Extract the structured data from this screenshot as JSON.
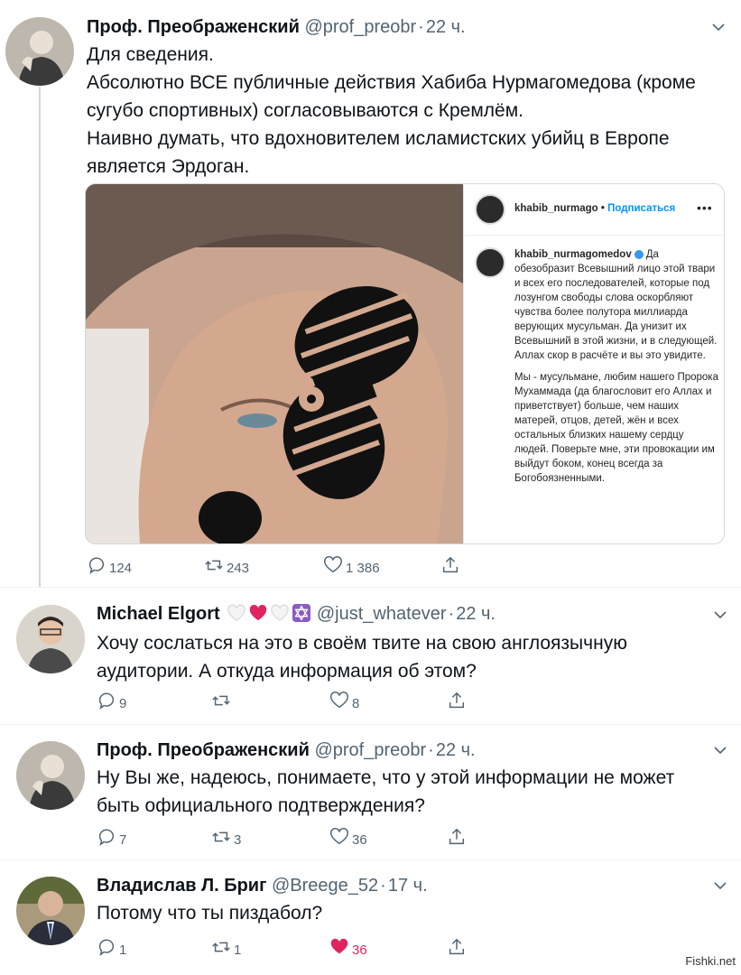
{
  "tweets": [
    {
      "name": "Проф. Преображенский",
      "handle": "@prof_preobr",
      "time": "22 ч.",
      "text": "Для сведения.\nАбсолютно ВСЕ публичные действия Хабиба Нурмагомедова (кроме\nсугубо спортивных) согласовываются с Кремлём.\nНаивно думать, что вдохновителем исламистских убийц в Европе\nявляется Эрдоган.",
      "replies": "124",
      "retweets": "243",
      "likes": "1 386"
    },
    {
      "name": "Michael Elgort",
      "name_emoji": [
        "white-heart",
        "red-heart",
        "white-heart",
        "star-of-david"
      ],
      "handle": "@just_whatever",
      "time": "22 ч.",
      "text": "Хочу сослаться на это в своём твите на свою англоязычную\nаудитории. А откуда информация об этом?",
      "replies": "9",
      "retweets": "",
      "likes": "8"
    },
    {
      "name": "Проф. Преображенский",
      "handle": "@prof_preobr",
      "time": "22 ч.",
      "text": "Ну Вы же, надеюсь, понимаете, что у этой информации не может\nбыть официального подтверждения?",
      "replies": "7",
      "retweets": "3",
      "likes": "36"
    },
    {
      "name": "Владислав Л. Бриг",
      "handle": "@Breege_52",
      "time": "17 ч.",
      "text": "Потому что ты пиздабол?",
      "replies": "1",
      "retweets": "1",
      "likes": "36"
    }
  ],
  "instagram": {
    "header_user": "khabib_nurmago",
    "follow_label": "Подписаться",
    "caption_user": "khabib_nurmagomedov",
    "caption_p1": "Да обезобразит Всевышний лицо этой твари и всех его последователей, которые под лозунгом свободы слова оскорбляют чувства более полутора миллиарда верующих мусульман. Да унизит их Всевышний в этой жизни, и в следующей. Аллах скор в расчёте и вы это увидите.",
    "caption_p2": "Мы - мусульмане, любим нашего Пророка Мухаммада (да благословит его Аллах и приветствует) больше, чем наших матерей, отцов, детей, жён и всех остальных близких нашему сердцу людей. Поверьте мне, эти провокации им выйдут боком, конец всегда за Богобоязненными."
  },
  "watermark": "Fishki.net",
  "colors": {
    "text": "#0f1419",
    "secondary": "#536471",
    "like": "#e0245e",
    "link": "#0095f6"
  }
}
